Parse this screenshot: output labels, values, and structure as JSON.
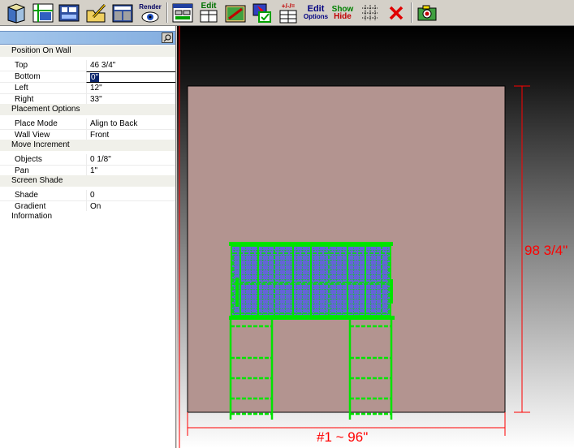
{
  "toolbar": {
    "edit1_label": "Edit",
    "render_label": "Render",
    "plusminus_label": "+/-/=",
    "edit_options_label1": "Edit",
    "edit_options_label2": "Options",
    "show_label": "Show",
    "hide_label": "Hide"
  },
  "panel": {
    "sections": {
      "position": "Position On Wall",
      "placement": "Placement Options",
      "move": "Move Increment",
      "shade": "Screen Shade",
      "info": "Information"
    },
    "rows": {
      "top": {
        "key": "Top",
        "value": "46 3/4\""
      },
      "bottom": {
        "key": "Bottom",
        "value": "0\""
      },
      "left": {
        "key": "Left",
        "value": "12\""
      },
      "right": {
        "key": "Right",
        "value": "33\""
      },
      "place_mode": {
        "key": "Place Mode",
        "value": "Align to Back"
      },
      "wall_view": {
        "key": "Wall View",
        "value": "Front"
      },
      "objects": {
        "key": "Objects",
        "value": "0 1/8\""
      },
      "pan": {
        "key": "Pan",
        "value": "1\""
      },
      "shade": {
        "key": "Shade",
        "value": "0"
      },
      "gradient": {
        "key": "Gradient",
        "value": "On"
      }
    }
  },
  "canvas": {
    "height_dim": "98 3/4\"",
    "width_dim": "#1 ~ 96\""
  },
  "colors": {
    "wall": "#b39490",
    "cabinet": "#00e400",
    "cabinet_fill": "#6a6ae0",
    "dim": "#ff0000"
  }
}
